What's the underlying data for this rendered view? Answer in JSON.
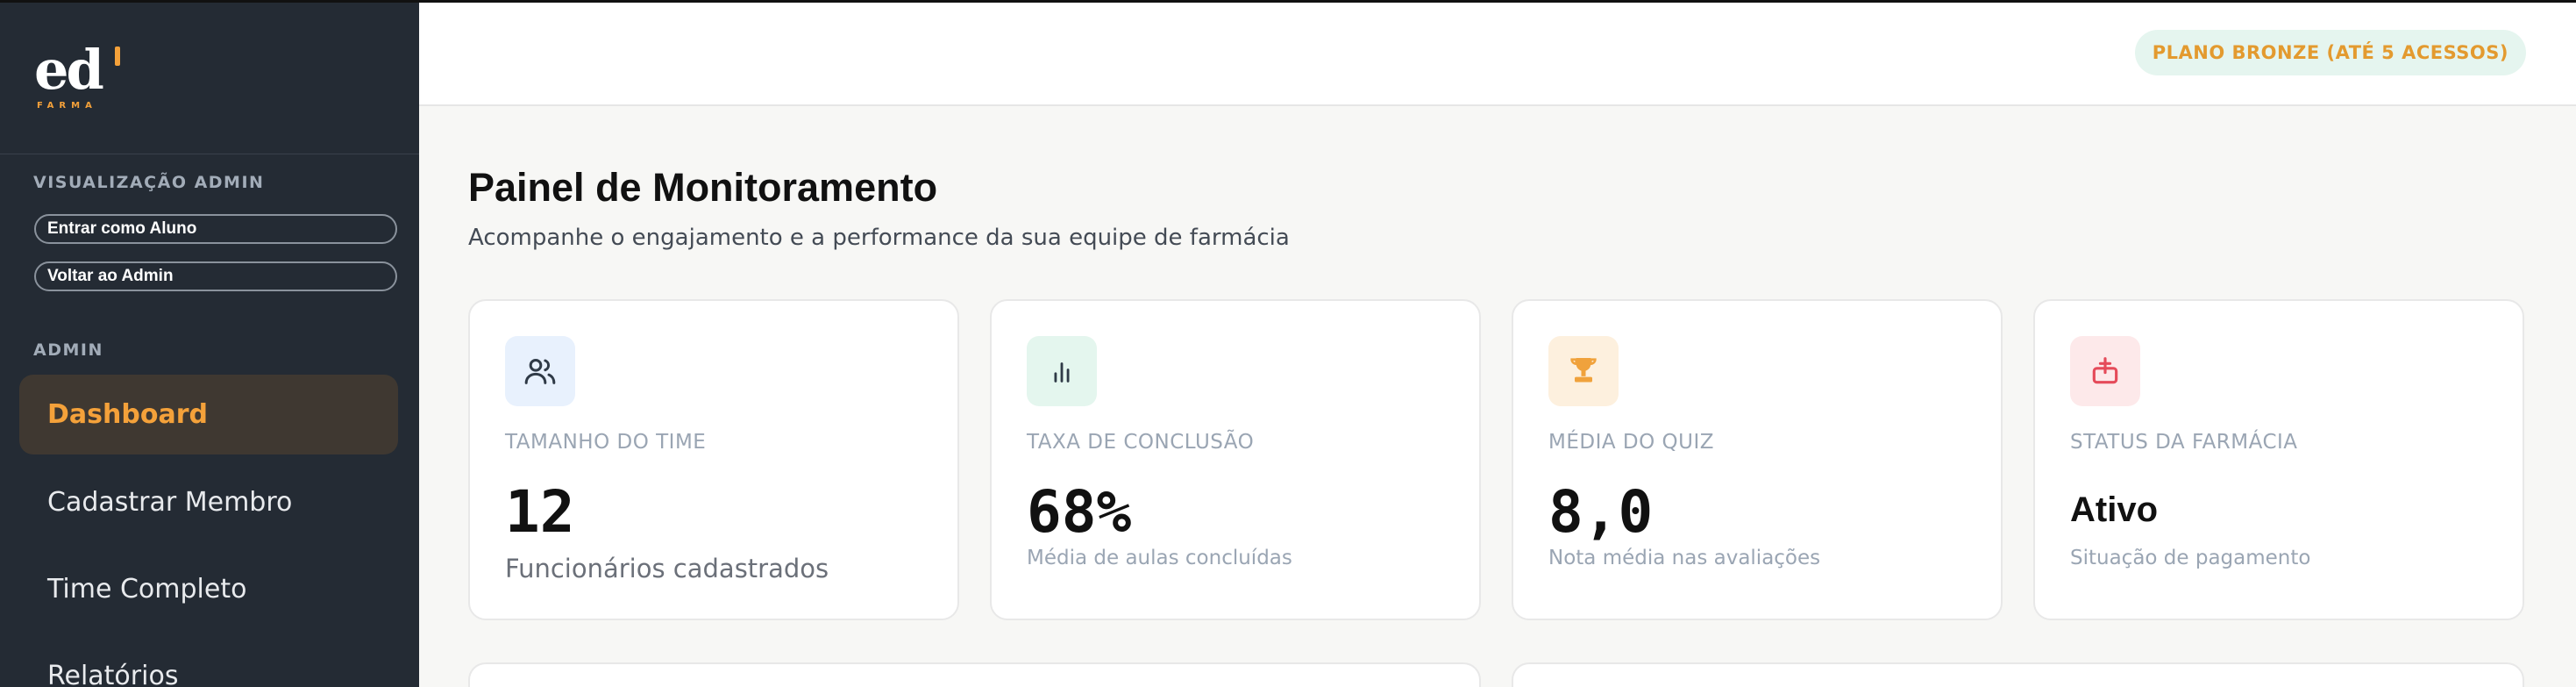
{
  "brand": {
    "wordmark": "ed",
    "sub": "FARMA",
    "accent": "#f4a13a"
  },
  "sidebar": {
    "admin_view_title": "VISUALIZAÇÃO ADMIN",
    "enter_as_student": "Entrar como Aluno",
    "back_to_admin": "Voltar ao Admin",
    "admin_section_title": "ADMIN",
    "items": [
      {
        "label": "Dashboard",
        "active": true
      },
      {
        "label": "Cadastrar Membro",
        "active": false
      },
      {
        "label": "Time Completo",
        "active": false
      },
      {
        "label": "Relatórios",
        "active": false
      }
    ]
  },
  "header": {
    "plan_badge": "PLANO BRONZE (ATÉ 5 ACESSOS)"
  },
  "main": {
    "title": "Painel de Monitoramento",
    "subtitle": "Acompanhe o engajamento e a performance da sua equipe de farmácia",
    "cards": [
      {
        "icon": "users-icon",
        "label": "TAMANHO DO TIME",
        "value": "12",
        "desc": "Funcionários cadastrados",
        "icon_bg": "#e8f1fd",
        "icon_color": "#2f3a47"
      },
      {
        "icon": "bar-chart-icon",
        "label": "TAXA DE CONCLUSÃO",
        "value": "68%",
        "desc": "Média de aulas concluídas",
        "icon_bg": "#e4f6ee",
        "icon_color": "#2f3a47"
      },
      {
        "icon": "trophy-icon",
        "label": "MÉDIA DO QUIZ",
        "value": "8,0",
        "desc": "Nota média nas avaliações",
        "icon_bg": "#fdf0de",
        "icon_color": "#f0a23c"
      },
      {
        "icon": "inbox-upload-icon",
        "label": "STATUS DA FARMÁCIA",
        "value": "Ativo",
        "desc": "Situação de pagamento",
        "icon_bg": "#fde9ea",
        "icon_color": "#e54b5a"
      }
    ]
  }
}
